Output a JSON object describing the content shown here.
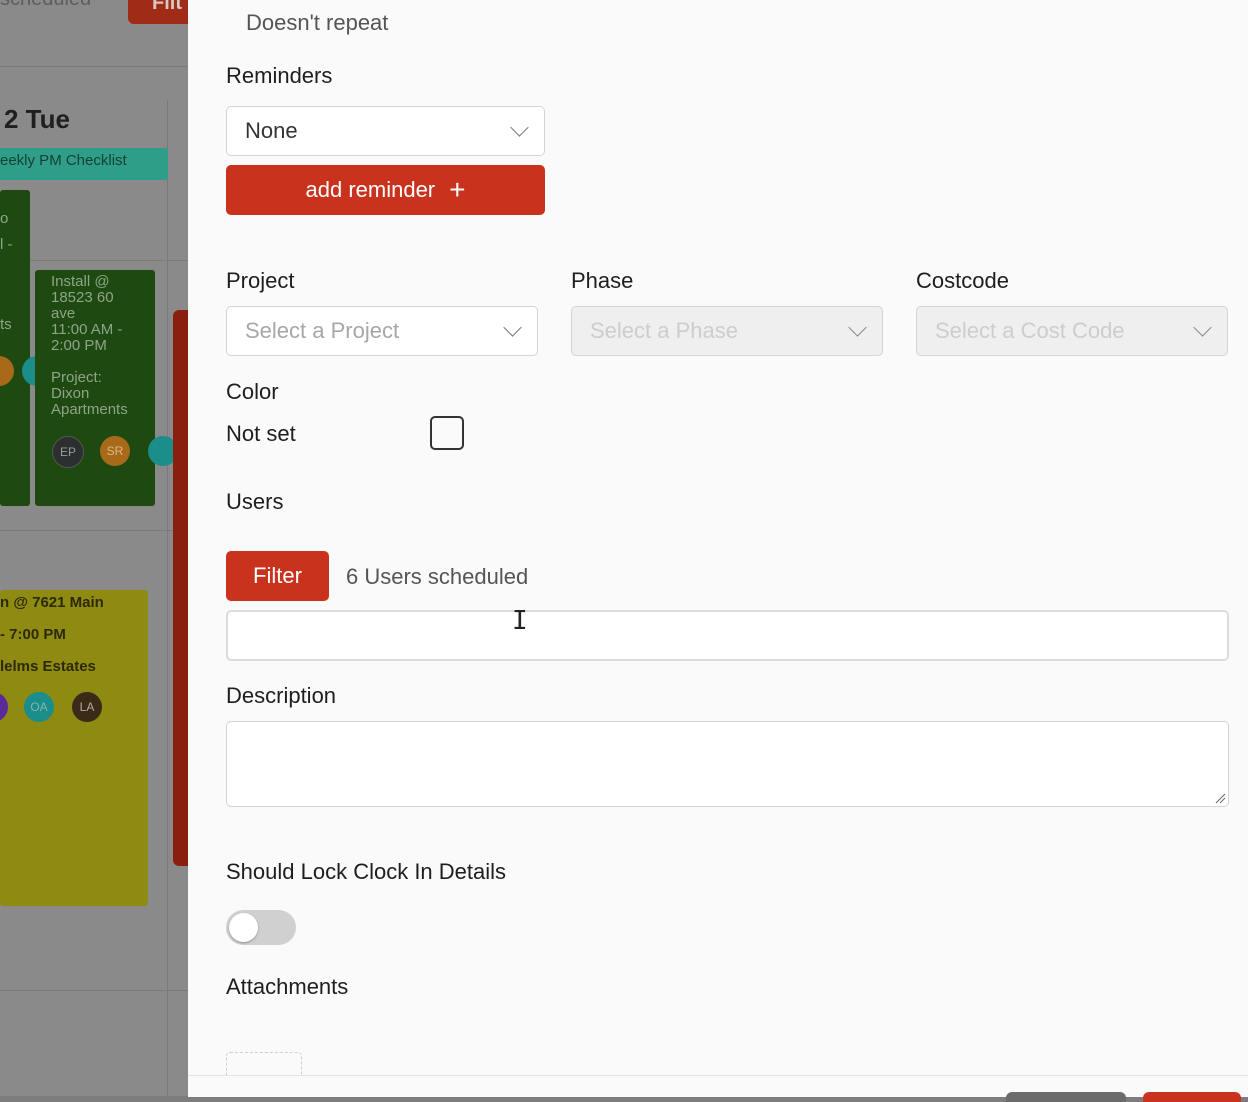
{
  "background": {
    "scheduled_text": "scheduled",
    "filter_label": "Filt",
    "day_label": "2 Tue",
    "pm_event": "eekly PM Checklist",
    "event_left": {
      "line1": "o",
      "line2": "l -",
      "line3": "ts"
    },
    "event_green": {
      "lines": [
        "Install @",
        "18523 60",
        "ave",
        "11:00 AM -",
        "2:00 PM",
        "",
        "Project:",
        "Dixon",
        "Apartments"
      ],
      "avatars": [
        "EP",
        "SR"
      ]
    },
    "event_yellow": {
      "line1": "n @ 7621 Main",
      "line2": "- 7:00 PM",
      "line3": "lelms Estates",
      "avatars": [
        "OA",
        "LA"
      ]
    }
  },
  "form": {
    "repeat_value": "Doesn't repeat",
    "reminders_label": "Reminders",
    "reminder_select_value": "None",
    "add_reminder_label": "add reminder",
    "project_label": "Project",
    "project_placeholder": "Select a Project",
    "phase_label": "Phase",
    "phase_placeholder": "Select a Phase",
    "costcode_label": "Costcode",
    "costcode_placeholder": "Select a Cost Code",
    "color_label": "Color",
    "color_value": "Not set",
    "users_label": "Users",
    "filter_label": "Filter",
    "users_scheduled": "6 Users scheduled",
    "description_label": "Description",
    "lock_label": "Should Lock Clock In Details",
    "lock_enabled": false,
    "attachments_label": "Attachments"
  },
  "colors": {
    "accent": "#c9321c",
    "drawer_bg": "#fafafa"
  }
}
